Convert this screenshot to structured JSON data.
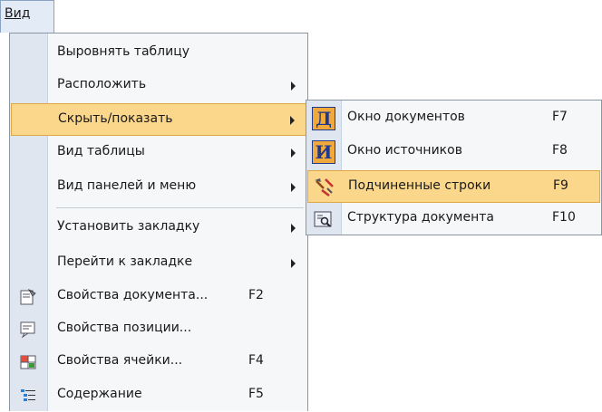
{
  "menubar": {
    "menu_label": "Вид"
  },
  "menu": {
    "items": [
      {
        "label": "Выровнять таблицу",
        "shortcut": "",
        "submenu": false
      },
      {
        "label": "Расположить",
        "shortcut": "",
        "submenu": true
      },
      {
        "label": "Скрыть/показать",
        "shortcut": "",
        "submenu": true,
        "highlighted": true
      },
      {
        "label": "Вид таблицы",
        "shortcut": "",
        "submenu": true
      },
      {
        "label": "Вид панелей и меню",
        "shortcut": "",
        "submenu": true
      },
      {
        "label": "Установить закладку",
        "shortcut": "",
        "submenu": true
      },
      {
        "label": "Перейти к закладке",
        "shortcut": "",
        "submenu": true
      },
      {
        "label": "Свойства документа...",
        "shortcut": "F2",
        "icon": "document-properties-icon"
      },
      {
        "label": "Свойства позиции...",
        "shortcut": "",
        "icon": "position-properties-icon"
      },
      {
        "label": "Свойства ячейки...",
        "shortcut": "F4",
        "icon": "cell-properties-icon"
      },
      {
        "label": "Содержание",
        "shortcut": "F5",
        "icon": "contents-icon"
      }
    ]
  },
  "submenu": {
    "items": [
      {
        "label": "Окно документов",
        "shortcut": "F7",
        "icon_letter": "Д"
      },
      {
        "label": "Окно источников",
        "shortcut": "F8",
        "icon_letter": "И"
      },
      {
        "label": "Подчиненные строки",
        "shortcut": "F9",
        "icon": "subordinate-rows-icon",
        "highlighted": true
      },
      {
        "label": "Структура документа",
        "shortcut": "F10",
        "icon": "document-structure-icon"
      }
    ]
  },
  "colors": {
    "highlight": "#fbd78b",
    "gutter": "#dfe6f0",
    "icon_orange": "#f2a93b",
    "icon_blue": "#1f3a8c"
  }
}
